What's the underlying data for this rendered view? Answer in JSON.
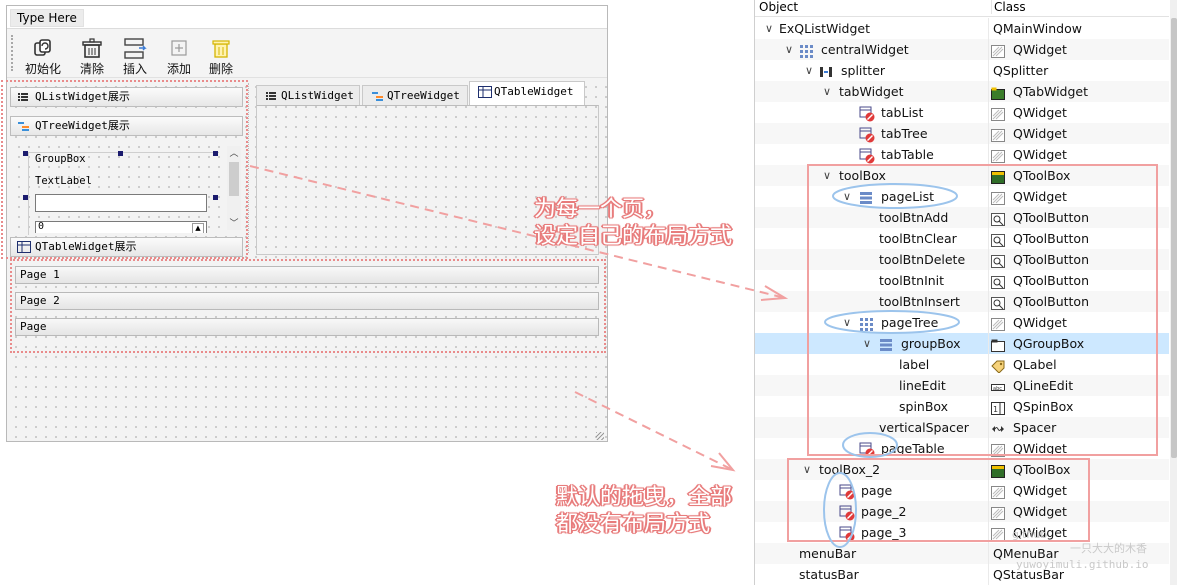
{
  "form": {
    "menu_item": "Type Here",
    "toolbar": [
      {
        "label": "初始化",
        "icon": "init-icon"
      },
      {
        "label": "清除",
        "icon": "clear-icon"
      },
      {
        "label": "插入",
        "icon": "insert-icon"
      },
      {
        "label": "添加",
        "icon": "add-icon"
      },
      {
        "label": "删除",
        "icon": "delete-icon"
      }
    ],
    "toolbox_pages": [
      "QListWidget展示",
      "QTreeWidget展示",
      "QTableWidget展示"
    ],
    "groupbox_label": "GroupBox",
    "text_label": "TextLabel",
    "spin_value": "0",
    "tabs": [
      "QListWidget",
      "QTreeWidget",
      "QTableWidget"
    ],
    "toolbox2_pages": [
      "Page 1",
      "Page 2",
      "Page"
    ]
  },
  "inspector": {
    "col_object": "Object",
    "col_class": "Class",
    "rows": [
      {
        "name": "ExQListWidget",
        "cls": "QMainWindow"
      },
      {
        "name": "centralWidget",
        "cls": "QWidget"
      },
      {
        "name": "splitter",
        "cls": "QSplitter"
      },
      {
        "name": "tabWidget",
        "cls": "QTabWidget"
      },
      {
        "name": "tabList",
        "cls": "QWidget"
      },
      {
        "name": "tabTree",
        "cls": "QWidget"
      },
      {
        "name": "tabTable",
        "cls": "QWidget"
      },
      {
        "name": "toolBox",
        "cls": "QToolBox"
      },
      {
        "name": "pageList",
        "cls": "QWidget"
      },
      {
        "name": "toolBtnAdd",
        "cls": "QToolButton"
      },
      {
        "name": "toolBtnClear",
        "cls": "QToolButton"
      },
      {
        "name": "toolBtnDelete",
        "cls": "QToolButton"
      },
      {
        "name": "toolBtnInit",
        "cls": "QToolButton"
      },
      {
        "name": "toolBtnInsert",
        "cls": "QToolButton"
      },
      {
        "name": "pageTree",
        "cls": "QWidget"
      },
      {
        "name": "groupBox",
        "cls": "QGroupBox"
      },
      {
        "name": "label",
        "cls": "QLabel"
      },
      {
        "name": "lineEdit",
        "cls": "QLineEdit"
      },
      {
        "name": "spinBox",
        "cls": "QSpinBox"
      },
      {
        "name": "verticalSpacer",
        "cls": "Spacer"
      },
      {
        "name": "pageTable",
        "cls": "QWidget"
      },
      {
        "name": "toolBox_2",
        "cls": "QToolBox"
      },
      {
        "name": "page",
        "cls": "QWidget"
      },
      {
        "name": "page_2",
        "cls": "QWidget"
      },
      {
        "name": "page_3",
        "cls": "QWidget"
      },
      {
        "name": "menuBar",
        "cls": "QMenuBar"
      },
      {
        "name": "statusBar",
        "cls": "QStatusBar"
      }
    ]
  },
  "annotations": {
    "note1": [
      "为每一个页，",
      "设定自己的布局方式"
    ],
    "note2": [
      "默认的拖曳，全部",
      "都没有布局方式"
    ]
  },
  "watermark": [
    "github",
    "一只大大的木香",
    "yuwoyimuli.github.io"
  ],
  "colors": {
    "annotation_red": "#e87d7d",
    "selection": "#cde8ff",
    "ellipse_blue": "#9cc4ec"
  }
}
